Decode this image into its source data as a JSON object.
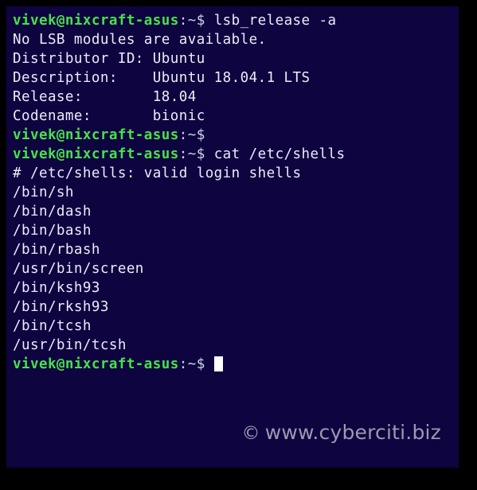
{
  "window": {
    "background_color": "#0e0440",
    "border_color": "#000000",
    "foreground_color": "#ececf8",
    "prompt_color": "#4ae04a"
  },
  "terminal": {
    "prompt": "vivek@nixcraft-asus",
    "prompt_suffix": ":~$",
    "lines": [
      {
        "type": "prompt",
        "prompt": "vivek@nixcraft-asus",
        "suffix": ":~$",
        "command": " lsb_release -a"
      },
      {
        "type": "output",
        "text": "No LSB modules are available."
      },
      {
        "type": "output",
        "text": "Distributor ID: Ubuntu"
      },
      {
        "type": "output",
        "text": "Description:    Ubuntu 18.04.1 LTS"
      },
      {
        "type": "output",
        "text": "Release:        18.04"
      },
      {
        "type": "output",
        "text": "Codename:       bionic"
      },
      {
        "type": "prompt",
        "prompt": "vivek@nixcraft-asus",
        "suffix": ":~$",
        "command": ""
      },
      {
        "type": "prompt",
        "prompt": "vivek@nixcraft-asus",
        "suffix": ":~$",
        "command": " cat /etc/shells"
      },
      {
        "type": "output",
        "text": "# /etc/shells: valid login shells"
      },
      {
        "type": "output",
        "text": "/bin/sh"
      },
      {
        "type": "output",
        "text": "/bin/dash"
      },
      {
        "type": "output",
        "text": "/bin/bash"
      },
      {
        "type": "output",
        "text": "/bin/rbash"
      },
      {
        "type": "output",
        "text": "/usr/bin/screen"
      },
      {
        "type": "output",
        "text": "/bin/ksh93"
      },
      {
        "type": "output",
        "text": "/bin/rksh93"
      },
      {
        "type": "output",
        "text": "/bin/tcsh"
      },
      {
        "type": "output",
        "text": "/usr/bin/tcsh"
      },
      {
        "type": "prompt-cursor",
        "prompt": "vivek@nixcraft-asus",
        "suffix": ":~$",
        "command": " "
      }
    ]
  },
  "watermark": {
    "symbol": "©",
    "text": "www.cyberciti.biz",
    "color": "#9a9ab0"
  }
}
